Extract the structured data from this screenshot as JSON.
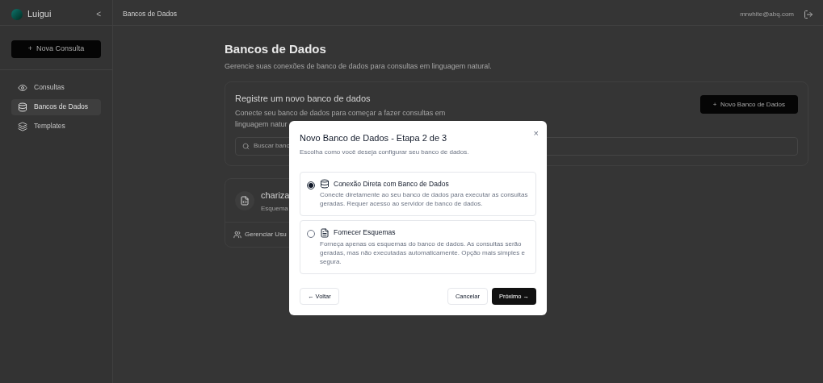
{
  "sidebar": {
    "brand": "Luigui",
    "collapse": "<",
    "new_button": "+  Nova Consulta",
    "items": [
      {
        "label": "Consultas",
        "kind": "eye",
        "selected": false
      },
      {
        "label": "Bancos de Dados",
        "kind": "database",
        "selected": true
      },
      {
        "label": "Templates",
        "kind": "layers",
        "selected": false
      }
    ]
  },
  "topbar": {
    "breadcrumb": "Bancos de Dados",
    "user": "mrwhite@abq.com"
  },
  "page": {
    "title": "Bancos de Dados",
    "subtitle": "Gerencie suas conexões de banco de dados para consultas em linguagem natural.",
    "register": {
      "title": "Registre um novo banco de dados",
      "description_1": "Conecte seu banco de dados para começar a fazer consultas em",
      "description_2": "linguagem natur",
      "button": "+  Novo Banco de Dados",
      "search_placeholder": "Buscar banc"
    },
    "database_card": {
      "name": "chariza",
      "type": "Esquema",
      "manage": "Gerenciar Usu"
    }
  },
  "dialog": {
    "title": "Novo Banco de Dados - Etapa 2 de 3",
    "description": "Escolha como você deseja configurar seu banco de dados.",
    "close": "×",
    "options": [
      {
        "kind": "database",
        "title": "Conexão Direta com Banco de Dados",
        "description": "Conecte diretamente ao seu banco de dados para executar as consultas geradas. Requer acesso ao servidor de banco de dados.",
        "selected": true
      },
      {
        "kind": "schema",
        "title": "Fornecer Esquemas",
        "description": "Forneça apenas os esquemas do banco de dados. As consultas serão geradas, mas não executadas automaticamente. Opção mais simples e segura.",
        "selected": false
      }
    ],
    "back": "← Voltar",
    "cancel": "Cancelar",
    "next": "Próximo →"
  }
}
